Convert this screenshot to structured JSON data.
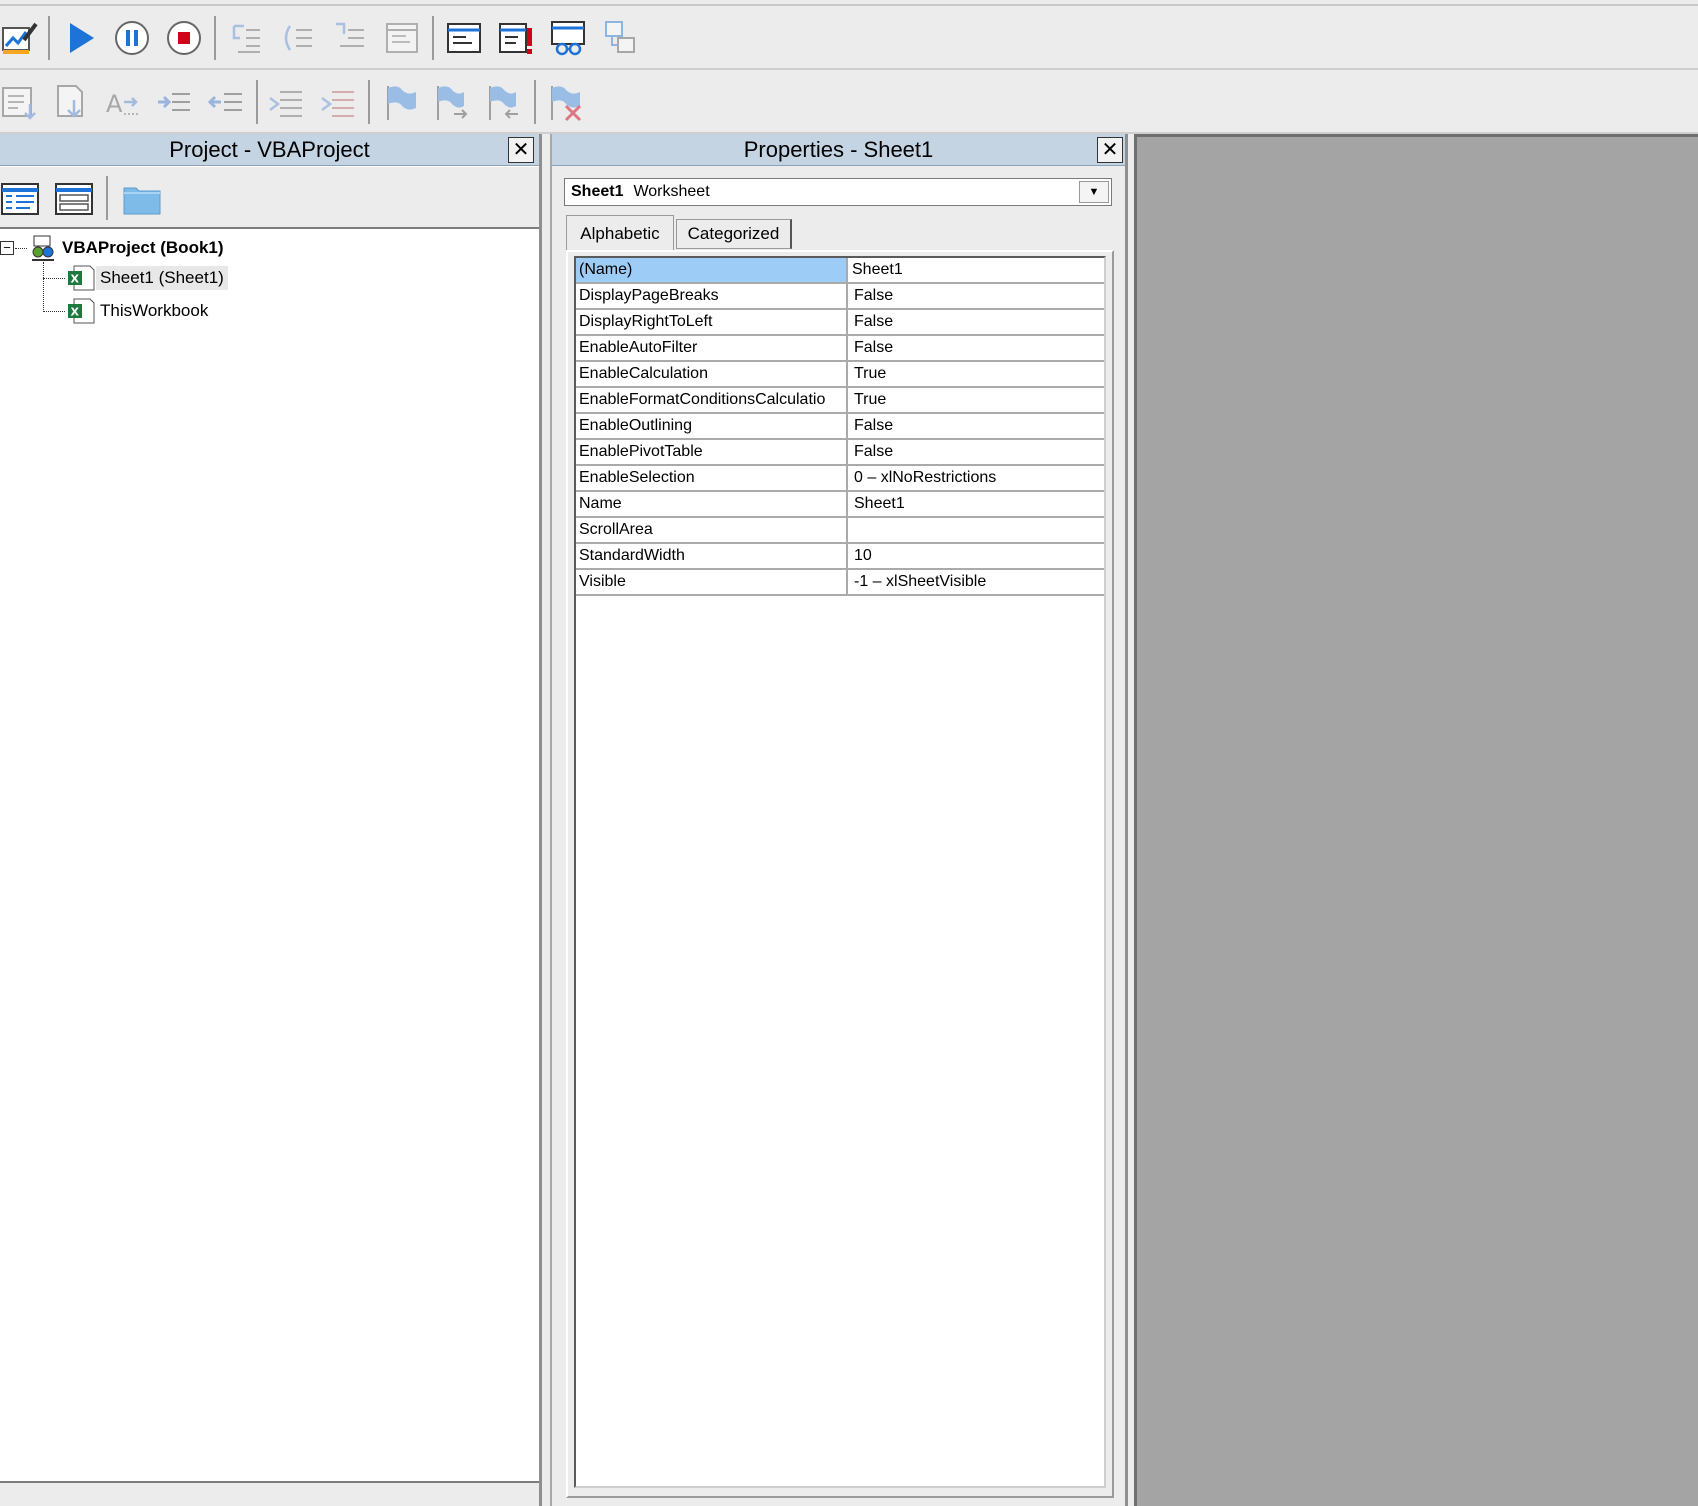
{
  "toolbar1": {
    "buttons": [
      {
        "name": "design-mode-icon"
      },
      {
        "name": "run-icon"
      },
      {
        "name": "break-icon"
      },
      {
        "name": "reset-icon"
      },
      {
        "name": "step-into-icon"
      },
      {
        "name": "step-over-icon"
      },
      {
        "name": "step-out-icon"
      },
      {
        "name": "run-to-cursor-icon"
      },
      {
        "name": "locals-window-icon"
      },
      {
        "name": "immediate-window-icon"
      },
      {
        "name": "watch-window-icon"
      },
      {
        "name": "call-stack-icon"
      }
    ]
  },
  "toolbar2": {
    "buttons": [
      {
        "name": "list-properties-icon"
      },
      {
        "name": "list-constants-icon"
      },
      {
        "name": "quick-info-icon"
      },
      {
        "name": "indent-icon"
      },
      {
        "name": "outdent-icon"
      },
      {
        "name": "comment-block-icon"
      },
      {
        "name": "uncomment-block-icon"
      },
      {
        "name": "toggle-bookmark-icon"
      },
      {
        "name": "next-bookmark-icon"
      },
      {
        "name": "previous-bookmark-icon"
      },
      {
        "name": "clear-bookmarks-icon"
      }
    ]
  },
  "project": {
    "title": "Project - VBAProject",
    "close": "✕",
    "tree": {
      "root": "VBAProject (Book1)",
      "expander": "−",
      "children": [
        "Sheet1 (Sheet1)",
        "ThisWorkbook"
      ],
      "selected": 0
    }
  },
  "properties": {
    "title": "Properties - Sheet1",
    "close": "✕",
    "object": {
      "name": "Sheet1",
      "type": "Worksheet"
    },
    "tabs": [
      "Alphabetic",
      "Categorized"
    ],
    "active_tab": 0,
    "rows": [
      {
        "name": "(Name)",
        "value": "Sheet1"
      },
      {
        "name": "DisplayPageBreaks",
        "value": "False"
      },
      {
        "name": "DisplayRightToLeft",
        "value": "False"
      },
      {
        "name": "EnableAutoFilter",
        "value": "False"
      },
      {
        "name": "EnableCalculation",
        "value": "True"
      },
      {
        "name": "EnableFormatConditionsCalculatio",
        "value": "True"
      },
      {
        "name": "EnableOutlining",
        "value": "False"
      },
      {
        "name": "EnablePivotTable",
        "value": "False"
      },
      {
        "name": "EnableSelection",
        "value": "0 – xlNoRestrictions"
      },
      {
        "name": "Name",
        "value": "Sheet1"
      },
      {
        "name": "ScrollArea",
        "value": ""
      },
      {
        "name": "StandardWidth",
        "value": "10"
      },
      {
        "name": "Visible",
        "value": "-1 – xlSheetVisible"
      }
    ]
  },
  "colors": {
    "title_bar": "#c5d4e3",
    "selection": "#9dccf6",
    "workspace": "#a4a4a4",
    "run_blue": "#1e73d8",
    "stop_red": "#d0021b"
  }
}
